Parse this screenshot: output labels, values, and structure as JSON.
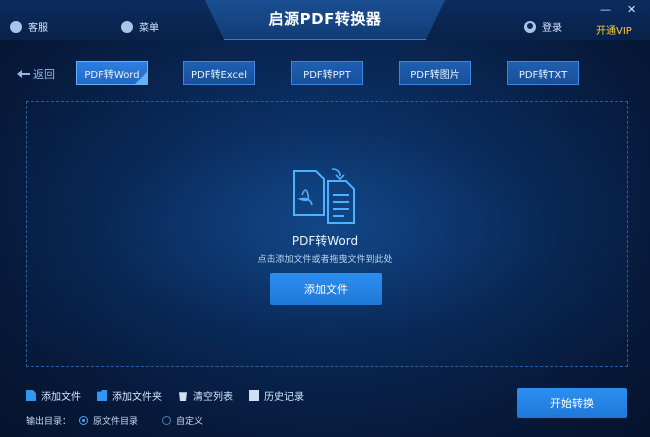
{
  "app": {
    "title": "启源PDF转换器",
    "service": "客服",
    "menu": "菜单",
    "login": "登录",
    "vip": "开通VIP",
    "minimize": "—",
    "close": "✕"
  },
  "nav": {
    "back": "返回",
    "tabs": [
      {
        "label": "PDF转Word",
        "active": true
      },
      {
        "label": "PDF转Excel",
        "active": false
      },
      {
        "label": "PDF转PPT",
        "active": false
      },
      {
        "label": "PDF转图片",
        "active": false
      },
      {
        "label": "PDF转TXT",
        "active": false
      }
    ]
  },
  "drop": {
    "title": "PDF转Word",
    "hint": "点击添加文件或者拖曳文件到此处",
    "add_button": "添加文件"
  },
  "bottom": {
    "add_file": "添加文件",
    "add_folder": "添加文件夹",
    "clear_list": "清空列表",
    "history": "历史记录",
    "output_label": "输出目录：",
    "opt_source": "原文件目录",
    "opt_custom": "自定义",
    "start_button": "开始转换"
  },
  "colors": {
    "accent": "#2b8ff0",
    "vip": "#ffcc33"
  }
}
